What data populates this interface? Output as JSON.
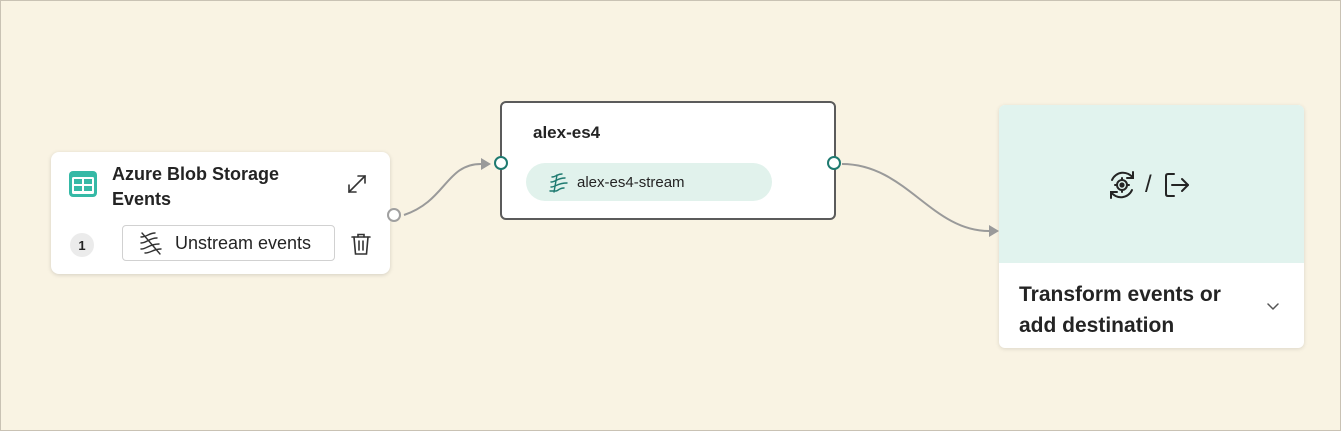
{
  "source_node": {
    "title": "Azure Blob Storage Events",
    "badge_count": "1",
    "unstream_label": "Unstream events",
    "icon": "storage-table-icon"
  },
  "eventstream_node": {
    "title": "alex-es4",
    "stream_label": "alex-es4-stream",
    "icon": "stream-icon"
  },
  "destination_node": {
    "label": "Transform events or add destination",
    "icons": [
      "transform-gear-icon",
      "export-arrow-icon"
    ],
    "separator": "/"
  },
  "colors": {
    "canvas": "#f9f3e3",
    "accent_teal": "#1e7a70",
    "stream_pill": "#e1f2ec",
    "dest_panel": "#e1f3ee"
  }
}
